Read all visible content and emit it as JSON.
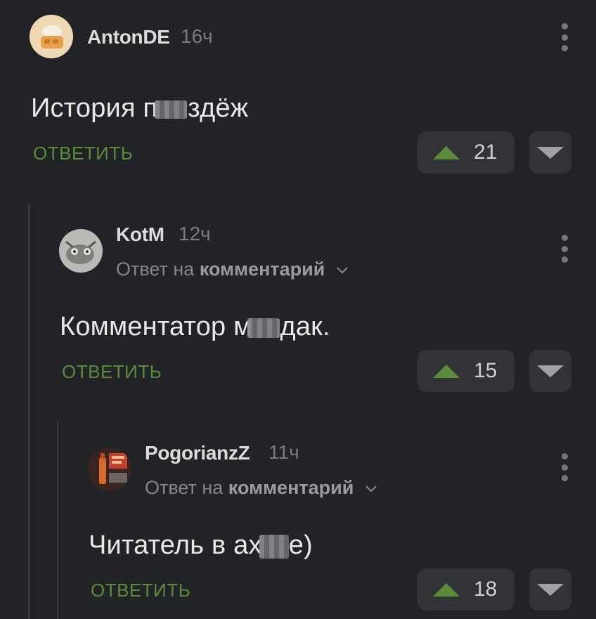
{
  "comments": [
    {
      "username": "AntonDE",
      "time": "16ч",
      "text_before": "История п",
      "text_after": "здёж",
      "reply_label": "ОТВЕТИТЬ",
      "score": "21"
    },
    {
      "username": "KotM",
      "time": "12ч",
      "reply_to_prefix": "Ответ на",
      "reply_to_target": "комментарий",
      "text_before": "Комментатор м",
      "text_after": "дак.",
      "reply_label": "ОТВЕТИТЬ",
      "score": "15"
    },
    {
      "username": "PogorianzZ",
      "time": "11ч",
      "reply_to_prefix": "Ответ на",
      "reply_to_target": "комментарий",
      "text_before": "Читатель в ах",
      "text_after": "е)",
      "reply_label": "ОТВЕТИТЬ",
      "score": "18"
    }
  ],
  "colors": {
    "background": "#222326",
    "accent_green": "#5b8c3a",
    "vote_box": "#323337"
  },
  "icons": [
    "avatar",
    "more-vertical-icon",
    "upvote-icon",
    "downvote-icon",
    "chevron-down-icon"
  ]
}
